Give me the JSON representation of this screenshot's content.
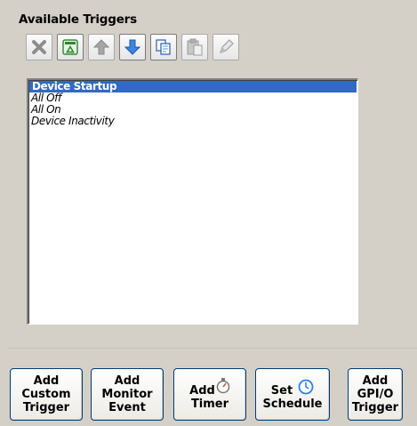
{
  "section": {
    "title": "Available Triggers"
  },
  "toolbar": {
    "buttons": [
      {
        "icon": "delete-icon",
        "enabled": false
      },
      {
        "icon": "trigger-edit-icon",
        "enabled": true
      },
      {
        "icon": "arrow-up-icon",
        "enabled": false
      },
      {
        "icon": "arrow-down-icon",
        "enabled": true
      },
      {
        "icon": "copy-icon",
        "enabled": true
      },
      {
        "icon": "paste-icon",
        "enabled": false
      },
      {
        "icon": "pencil-icon",
        "enabled": false
      }
    ]
  },
  "triggers": [
    {
      "label": "Device Startup",
      "selected": true
    },
    {
      "label": "All Off",
      "selected": false
    },
    {
      "label": "All On",
      "selected": false
    },
    {
      "label": "Device Inactivity",
      "selected": false
    }
  ],
  "actions": {
    "add_custom_trigger": [
      "Add",
      "Custom",
      "Trigger"
    ],
    "add_monitor_event": [
      "Add",
      "Monitor",
      "Event"
    ],
    "add_timer": [
      "Add",
      "Timer"
    ],
    "set_schedule": [
      "Set",
      "Schedule"
    ],
    "add_gpio_trigger": [
      "Add",
      "GPI/O",
      "Trigger"
    ]
  },
  "colors": {
    "selection": "#316ac5",
    "button_border": "#003c74",
    "face": "#d4d0c8"
  }
}
